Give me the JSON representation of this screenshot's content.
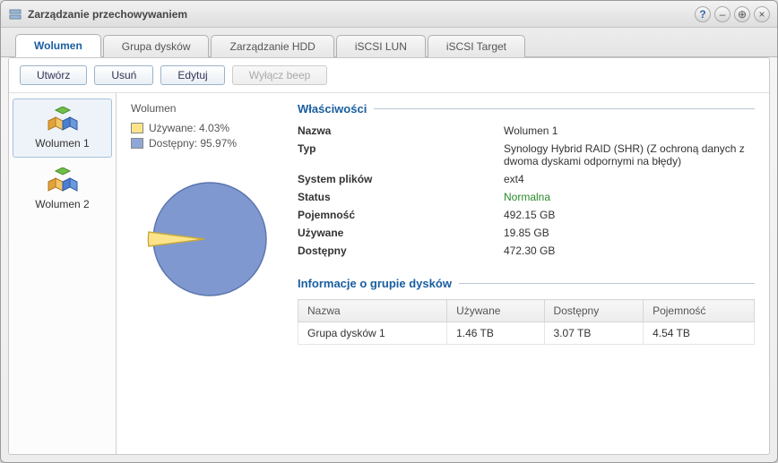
{
  "window": {
    "title": "Zarządzanie przechowywaniem"
  },
  "tabs": [
    {
      "label": "Wolumen"
    },
    {
      "label": "Grupa dysków"
    },
    {
      "label": "Zarządzanie HDD"
    },
    {
      "label": "iSCSI LUN"
    },
    {
      "label": "iSCSI Target"
    }
  ],
  "toolbar": {
    "create_label": "Utwórz",
    "delete_label": "Usuń",
    "edit_label": "Edytuj",
    "beep_label": "Wyłącz beep"
  },
  "sidebar": {
    "items": [
      {
        "label": "Wolumen 1"
      },
      {
        "label": "Wolumen 2"
      }
    ]
  },
  "overview": {
    "heading": "Wolumen",
    "used_label": "Używane: 4.03%",
    "avail_label": "Dostępny: 95.97%"
  },
  "chart_data": {
    "type": "pie",
    "title": "",
    "series": [
      {
        "name": "Używane",
        "value": 4.03,
        "color": "#fde48a"
      },
      {
        "name": "Dostępny",
        "value": 95.97,
        "color": "#7f98cf"
      }
    ]
  },
  "properties": {
    "section_title": "Właściwości",
    "rows": {
      "name_label": "Nazwa",
      "name_value": "Wolumen 1",
      "type_label": "Typ",
      "type_value": "Synology Hybrid RAID (SHR) (Z ochroną danych z dwoma dyskami odpornymi na błędy)",
      "fs_label": "System plików",
      "fs_value": "ext4",
      "status_label": "Status",
      "status_value": "Normalna",
      "cap_label": "Pojemność",
      "cap_value": "492.15 GB",
      "used_label": "Używane",
      "used_value": "19.85 GB",
      "avail_label": "Dostępny",
      "avail_value": "472.30 GB"
    }
  },
  "diskgroup": {
    "section_title": "Informacje o grupie dysków",
    "columns": {
      "name": "Nazwa",
      "used": "Używane",
      "avail": "Dostępny",
      "cap": "Pojemność"
    },
    "rows": [
      {
        "name": "Grupa dysków 1",
        "used": "1.46 TB",
        "avail": "3.07 TB",
        "cap": "4.54 TB"
      }
    ]
  }
}
